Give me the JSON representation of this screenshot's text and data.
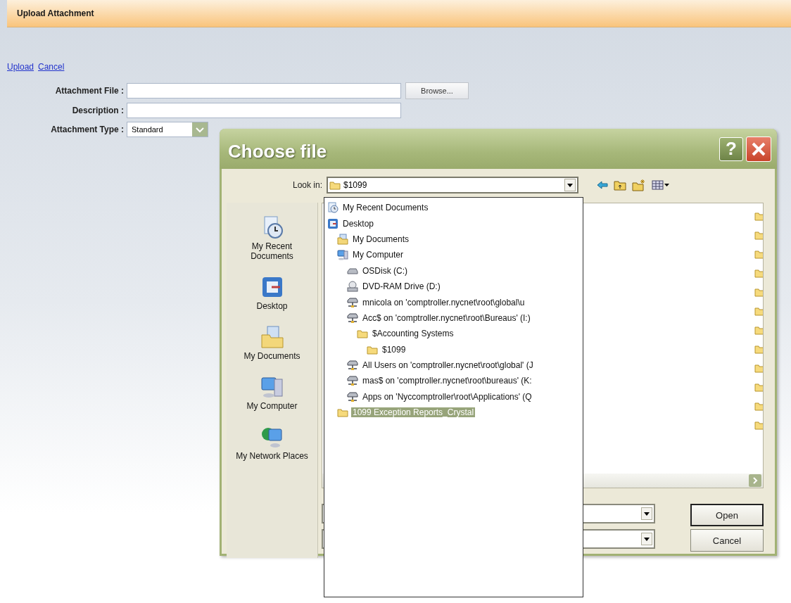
{
  "page": {
    "title": "Upload Attachment",
    "links": [
      "Upload",
      "Cancel"
    ],
    "fields": [
      {
        "label": "Attachment File :",
        "kind": "file",
        "button": "Browse..."
      },
      {
        "label": "Description :",
        "kind": "text"
      },
      {
        "label": "Attachment Type :",
        "kind": "select",
        "value": "Standard"
      }
    ]
  },
  "dialog": {
    "title": "Choose file",
    "help": "?",
    "look_in": {
      "label": "Look in:",
      "value": "$1099"
    },
    "places": [
      {
        "label": "My Recent Documents",
        "kind": "recent"
      },
      {
        "label": "Desktop",
        "kind": "desktop"
      },
      {
        "label": "My Documents",
        "kind": "documents"
      },
      {
        "label": "My Computer",
        "kind": "computer"
      },
      {
        "label": "My Network Places",
        "kind": "network"
      }
    ],
    "look_in_list": [
      {
        "label": "My Recent Documents",
        "kind": "recent",
        "selected": false
      },
      {
        "label": "Desktop",
        "kind": "desktop",
        "selected": false,
        "children": [
          {
            "label": "My Documents",
            "kind": "documents",
            "selected": false
          },
          {
            "label": "My Computer",
            "kind": "computer",
            "selected": false,
            "children": [
              {
                "label": "OSDisk (C:)",
                "kind": "disk",
                "selected": false
              },
              {
                "label": "DVD-RAM Drive (D:)",
                "kind": "dvd",
                "selected": false
              },
              {
                "label": "mnicola on 'comptroller.nycnet\\root\\global\\u",
                "kind": "network",
                "selected": false
              },
              {
                "label": "Acc$ on 'comptroller.nycnet\\root\\Bureaus' (I:)",
                "kind": "network",
                "selected": false,
                "children": [
                  {
                    "label": "$Accounting Systems",
                    "kind": "folder",
                    "selected": false,
                    "children": [
                      {
                        "label": "$1099",
                        "kind": "folder",
                        "selected": false
                      }
                    ]
                  }
                ]
              },
              {
                "label": "All Users on 'comptroller.nycnet\\root\\global' (J",
                "kind": "network",
                "selected": false
              },
              {
                "label": "mas$ on 'comptroller.nycnet\\root\\bureaus' (K:",
                "kind": "network",
                "selected": false
              },
              {
                "label": "Apps on 'Nyccomptroller\\root\\Applications' (Q",
                "kind": "network",
                "selected": false
              }
            ]
          },
          {
            "label": "1099 Exception Reports_Crystal",
            "kind": "folder",
            "selected": true
          }
        ]
      }
    ],
    "buttons": [
      "Open",
      "Cancel"
    ]
  }
}
